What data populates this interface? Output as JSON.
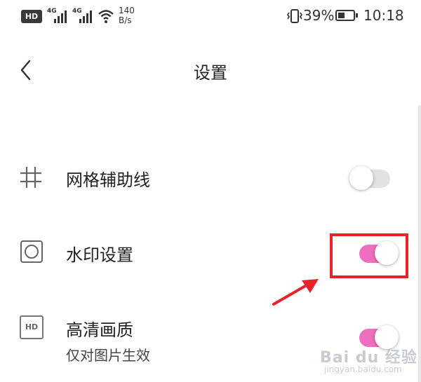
{
  "status_bar": {
    "hd": "HD",
    "net1": "4G",
    "net2": "4G",
    "speed_value": "140",
    "speed_unit": "B/s",
    "battery_percent": "39%",
    "time": "10:18"
  },
  "header": {
    "title": "设置"
  },
  "settings": {
    "grid": {
      "label": "网格辅助线",
      "enabled": false
    },
    "watermark": {
      "label": "水印设置",
      "enabled": true
    },
    "hd_quality": {
      "icon_text": "HD",
      "label": "高清画质",
      "sublabel": "仅对图片生效",
      "enabled": true
    }
  },
  "colors": {
    "accent": "#ee6fbd",
    "toggle_off": "#e2e2e2",
    "highlight": "#e5232a"
  },
  "watermark_logo": {
    "text": "Bai du 经验",
    "url_text": "jingyan.baidu.com"
  }
}
